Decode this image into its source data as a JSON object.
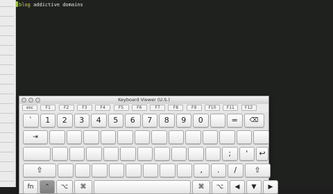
{
  "editor": {
    "line1_keyword": "blog",
    "line1_text": "addictive domains"
  },
  "keyboard_viewer": {
    "title": "Keyboard Viewer (U.S.)",
    "fkeys": [
      "esc",
      "F1",
      "F2",
      "F3",
      "F4",
      "F5",
      "F6",
      "F7",
      "F8",
      "F9",
      "F10",
      "F11",
      "F12"
    ],
    "number_row": [
      "`",
      "1",
      "2",
      "3",
      "4",
      "5",
      "6",
      "7",
      "8",
      "9",
      "0",
      "",
      "=",
      "⌫"
    ],
    "tab_row": {
      "tab": "⇥",
      "keys": [
        "",
        "",
        "",
        "",
        "",
        "",
        "",
        "",
        "",
        "",
        "",
        "",
        ""
      ]
    },
    "home_row": {
      "keys": [
        "",
        "",
        "",
        "",
        "",
        "",
        "",
        "",
        "",
        "",
        ";",
        "'",
        "↩"
      ]
    },
    "shift_row": {
      "left_shift": "⇧",
      "keys": [
        "",
        "",
        "",
        "",
        "",
        "",
        "",
        "",
        ",",
        ".",
        "/"
      ],
      "right_shift": "⇧"
    },
    "bottom_row": [
      "fn",
      "⌃",
      "⌥",
      "⌘",
      "",
      "⌘",
      "⌥",
      "◀",
      "▼",
      "▶"
    ]
  }
}
